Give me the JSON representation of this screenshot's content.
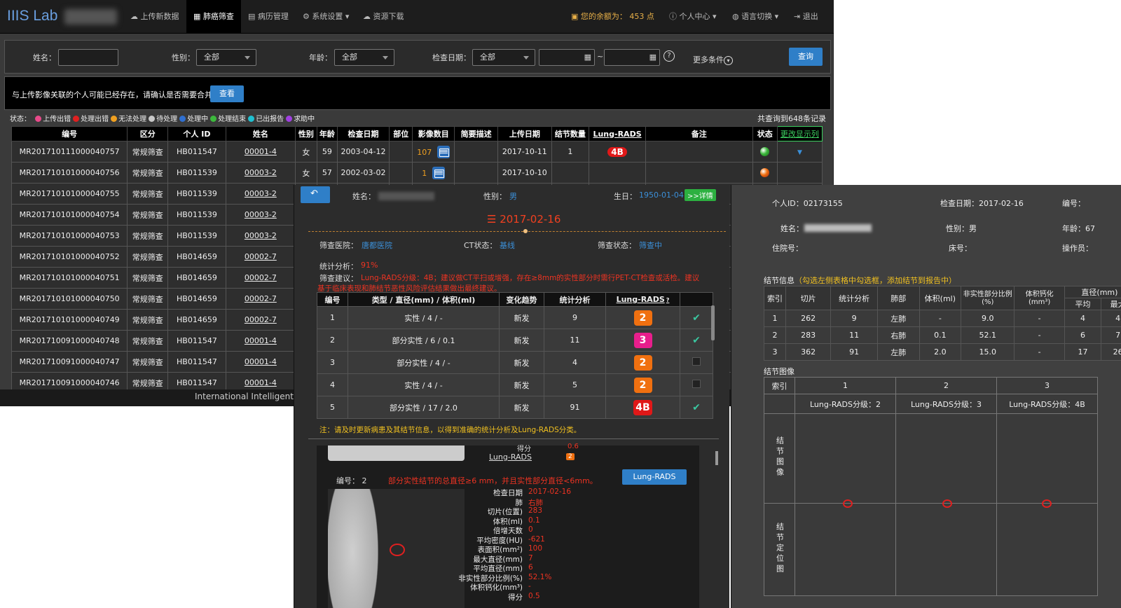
{
  "brand": {
    "name": "IIIS Lab"
  },
  "nav": {
    "upload": "上传新数据",
    "lung_screen": "肺癌筛查",
    "case_mgmt": "病历管理",
    "sys_settings": "系统设置",
    "resource_dl": "资源下载",
    "balance_label": "您的余额为：",
    "balance_value": "453",
    "balance_unit": "点",
    "profile": "个人中心",
    "lang": "语言切换",
    "logout": "退出"
  },
  "search": {
    "name_label": "姓名：",
    "gender_label": "性别：",
    "gender_value": "全部",
    "age_label": "年龄：",
    "age_value": "全部",
    "date_label": "检查日期：",
    "date_value": "全部",
    "range_sep": "~",
    "help": "?",
    "more": "更多条件",
    "query": "查询"
  },
  "notice": {
    "text": "与上传影像关联的个人可能已经存在，请确认是否需要合并！",
    "view": "查看"
  },
  "status_legend": {
    "prefix": "状态：",
    "items": [
      {
        "label": "上传出错",
        "color": "#e94a8a"
      },
      {
        "label": "处理出错",
        "color": "#e02020"
      },
      {
        "label": "无法处理",
        "color": "#f0a020"
      },
      {
        "label": "待处理",
        "color": "#c8c8c8"
      },
      {
        "label": "处理中",
        "color": "#2f6fd0"
      },
      {
        "label": "处理结束",
        "color": "#3cb83c"
      },
      {
        "label": "已出报告",
        "color": "#20c0d0"
      },
      {
        "label": "求助中",
        "color": "#a040e0"
      }
    ]
  },
  "total": "共查询到648条记录",
  "main_table": {
    "headers": [
      "编号",
      "区分",
      "个人 ID",
      "姓名",
      "性别",
      "年龄",
      "检查日期",
      "部位",
      "影像数目",
      "简要描述",
      "上传日期",
      "结节数量",
      "Lung-RADS",
      "备注",
      "状态",
      "更改显示列"
    ],
    "rows": [
      {
        "id": "MR201710111000040757",
        "type": "常规筛查",
        "pid": "HB011547",
        "name": "00001-4",
        "gender": "女",
        "age": "59",
        "date": "2003-04-12",
        "images": "107",
        "upload": "2017-10-11",
        "nodules": "1",
        "lungrads": "4B"
      },
      {
        "id": "MR201710101000040756",
        "type": "常规筛查",
        "pid": "HB011539",
        "name": "00003-2",
        "gender": "女",
        "age": "57",
        "date": "2002-03-02",
        "images": "1",
        "upload": "2017-10-10",
        "nodules": "",
        "lungrads": ""
      },
      {
        "id": "MR201710101000040755",
        "type": "常规筛查",
        "pid": "HB011539",
        "name": "00003-2",
        "gender": ":"
      },
      {
        "id": "MR201710101000040754",
        "type": "常规筛查",
        "pid": "HB011539",
        "name": "00003-2",
        "gender": ":"
      },
      {
        "id": "MR201710101000040753",
        "type": "常规筛查",
        "pid": "HB011539",
        "name": "00003-2",
        "gender": ":"
      },
      {
        "id": "MR201710101000040752",
        "type": "常规筛查",
        "pid": "HB014659",
        "name": "00002-7",
        "gender": "!"
      },
      {
        "id": "MR201710101000040751",
        "type": "常规筛查",
        "pid": "HB014659",
        "name": "00002-7",
        "gender": "!"
      },
      {
        "id": "MR201710101000040750",
        "type": "常规筛查",
        "pid": "HB014659",
        "name": "00002-7",
        "gender": "!"
      },
      {
        "id": "MR201710101000040749",
        "type": "常规筛查",
        "pid": "HB014659",
        "name": "00002-7",
        "gender": "!"
      },
      {
        "id": "MR201710091000040748",
        "type": "常规筛查",
        "pid": "HB011547",
        "name": "00001-4",
        "gender": ":"
      },
      {
        "id": "MR201710091000040747",
        "type": "常规筛查",
        "pid": "HB011547",
        "name": "00001-4",
        "gender": ":"
      },
      {
        "id": "MR201710091000040746",
        "type": "常规筛查",
        "pid": "HB011547",
        "name": "00001-4",
        "gender": ":"
      }
    ]
  },
  "footer": {
    "text": "International Intelligent In"
  },
  "detail": {
    "name_label": "姓名：",
    "gender_label": "性别：",
    "gender_value": "男",
    "birth_label": "生日：",
    "birth_value": "1950-01-04",
    "more_btn": ">>详情",
    "exam_date": "2017-02-16",
    "hospital_label": "筛查医院：",
    "hospital_value": "唐都医院",
    "ct_label": "CT状态：",
    "ct_value": "基线",
    "screen_label": "筛查状态：",
    "screen_value": "筛查中",
    "stat_label": "统计分析：",
    "stat_value": "91%",
    "advice_label": "筛查建议：",
    "advice_value": "Lung-RADS分级：4B；建议做CT平扫或增强，存在≥8mm的实性部分时需行PET-CT检查或活检。建议",
    "advice_value2": "基于临床表现和肺结节恶性风险评估结果做出最终建议。",
    "table_headers": [
      "编号",
      "类型 / 直径(mm) / 体积(ml)",
      "变化趋势",
      "统计分析",
      "Lung-RADS",
      ""
    ],
    "rows": [
      {
        "no": "1",
        "type": "实性 / 4 / -",
        "trend": "新发",
        "stat": "9",
        "lr": "2",
        "lr_color": "#f07010",
        "checked": true
      },
      {
        "no": "2",
        "type": "部分实性 / 6 / 0.1",
        "trend": "新发",
        "stat": "11",
        "lr": "3",
        "lr_color": "#e81e8c",
        "checked": true
      },
      {
        "no": "3",
        "type": "部分实性 / 4 / -",
        "trend": "新发",
        "stat": "4",
        "lr": "2",
        "lr_color": "#f07010",
        "checked": false
      },
      {
        "no": "4",
        "type": "实性 / 4 / -",
        "trend": "新发",
        "stat": "5",
        "lr": "2",
        "lr_color": "#f07010",
        "checked": false
      },
      {
        "no": "5",
        "type": "部分实性 / 17 / 2.0",
        "trend": "新发",
        "stat": "91",
        "lr": "4B",
        "lr_color": "#e01818",
        "checked": true
      }
    ],
    "note": "注：请及时更新病患及其结节信息，以得到准确的统计分析及Lung-RADS分类。",
    "sub_top_key": "得分",
    "sub_top_val": "0.6",
    "sub_top_lr_label": "Lung-RADS",
    "sub_top_lr_val": "2",
    "sub_no_label": "编号：",
    "sub_no_val": "2",
    "sub_desc": "部分实性结节的总直径≥6 mm，并且实性部分直径<6mm。",
    "sub_lr_btn": "Lung-RADS",
    "kv": [
      {
        "k": "检查日期",
        "v": "2017-02-16"
      },
      {
        "k": "肺",
        "v": "右肺"
      },
      {
        "k": "切片(位置)",
        "v": "283"
      },
      {
        "k": "体积(ml)",
        "v": "0.1"
      },
      {
        "k": "倍增天数",
        "v": "0"
      },
      {
        "k": "平均密度(HU)",
        "v": "-621"
      },
      {
        "k": "表面积(mm²)",
        "v": "100"
      },
      {
        "k": "最大直径(mm)",
        "v": "7"
      },
      {
        "k": "平均直径(mm)",
        "v": "6"
      },
      {
        "k": "非实性部分比例(%)",
        "v": "52.1%"
      },
      {
        "k": "体积钙化(mm³)",
        "v": "-"
      },
      {
        "k": "得分",
        "v": "0.5"
      }
    ]
  },
  "report": {
    "pid_label": "个人ID：",
    "pid_value": "02173155",
    "date_label": "检查日期：",
    "date_value": "2017-02-16",
    "no_label": "编号：",
    "name_label": "姓名：",
    "gender_label": "性别：",
    "gender_value": "男",
    "age_label": "年龄：",
    "age_value": "67",
    "hosp_label": "住院号：",
    "bed_label": "床号：",
    "operator_label": "操作员：",
    "nodule_info": "结节信息",
    "nodule_hint": "（勾选左侧表格中勾选框，添加结节到报告中）",
    "headers": [
      "索引",
      "切片",
      "统计分析",
      "肺部",
      "体积(ml)",
      "非实性部分比例(%)",
      "体积钙化(mm³)",
      "直径(mm)"
    ],
    "sub_headers": [
      "平均",
      "最大"
    ],
    "rows": [
      {
        "idx": "1",
        "slice": "262",
        "stat": "9",
        "lung": "左肺",
        "vol": "-",
        "ratio": "9.0",
        "calc": "-",
        "avg": "4",
        "max": "4"
      },
      {
        "idx": "2",
        "slice": "283",
        "stat": "11",
        "lung": "右肺",
        "vol": "0.1",
        "ratio": "52.1",
        "calc": "-",
        "avg": "6",
        "max": "7"
      },
      {
        "idx": "3",
        "slice": "362",
        "stat": "91",
        "lung": "左肺",
        "vol": "2.0",
        "ratio": "15.0",
        "calc": "-",
        "avg": "17",
        "max": "26"
      }
    ],
    "nodule_images": "结节图像",
    "img_idx_label": "索引",
    "img_cols": [
      {
        "idx": "1",
        "lr": "Lung-RADS分级：2"
      },
      {
        "idx": "2",
        "lr": "Lung-RADS分级：3"
      },
      {
        "idx": "3",
        "lr": "Lung-RADS分级：4B"
      }
    ],
    "row_label_img": "结节图像",
    "row_label_loc": "结节定位图"
  }
}
